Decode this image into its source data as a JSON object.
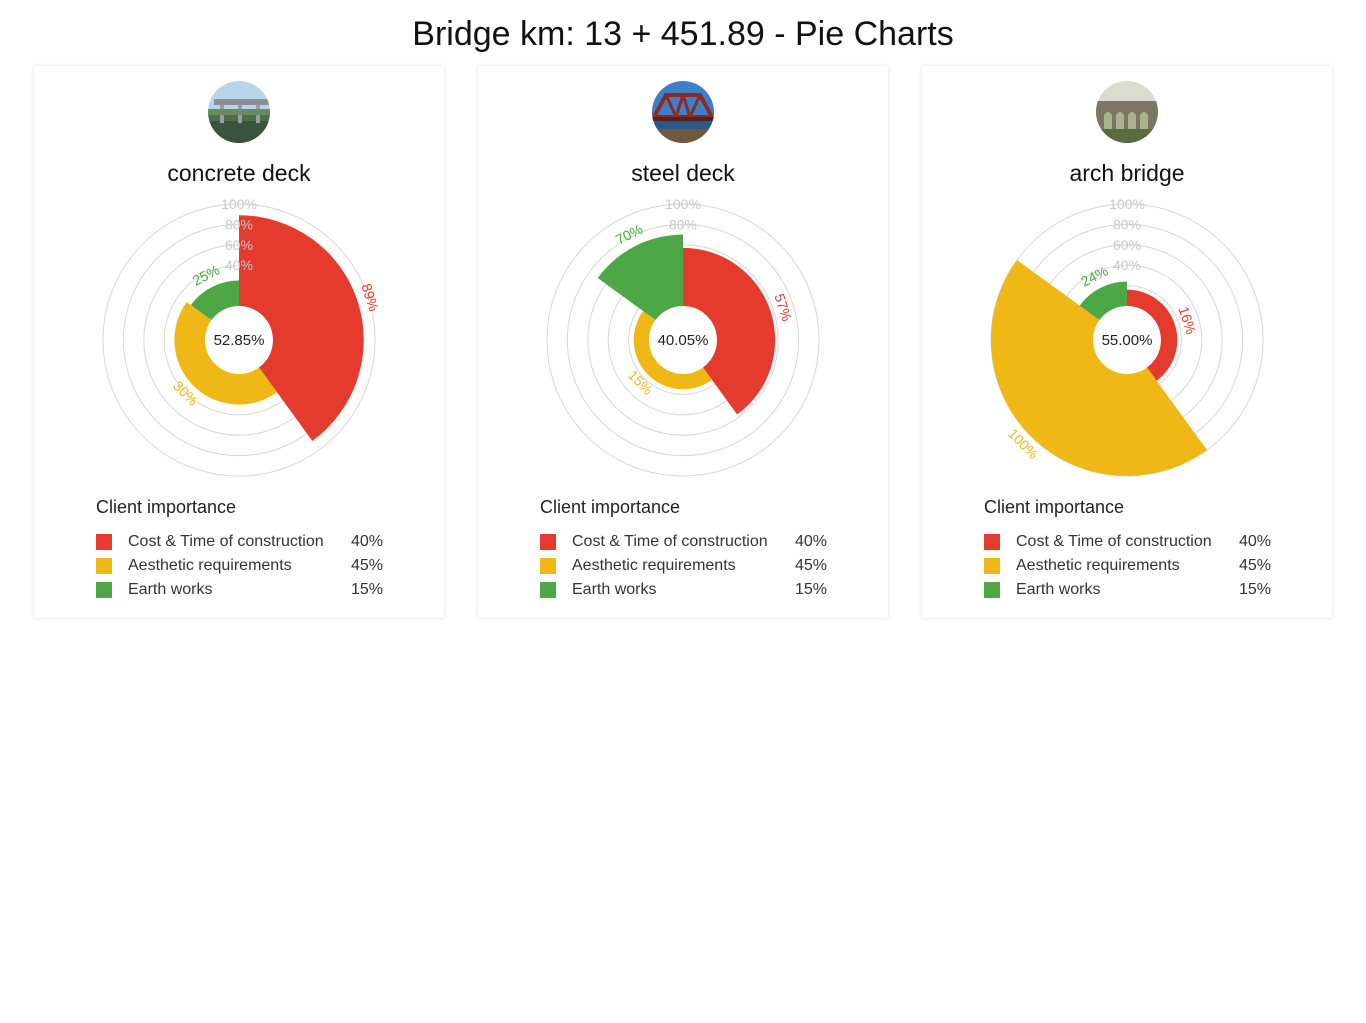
{
  "page": {
    "title": "Bridge km: 13 + 451.89 - Pie Charts"
  },
  "colors": {
    "red": "#e53b2f",
    "yellow": "#f0b816",
    "green": "#4ca744",
    "grid": "#d6d6d6",
    "tick": "#c8c8c8"
  },
  "legend_title": "Client importance",
  "legend": [
    {
      "label": "Cost & Time of construction",
      "value": "40%",
      "color": "#e53b2f"
    },
    {
      "label": "Aesthetic requirements",
      "value": "45%",
      "color": "#f0b816"
    },
    {
      "label": "Earth works",
      "value": "15%",
      "color": "#4ca744"
    }
  ],
  "cards": [
    {
      "title": "concrete deck",
      "image_icon": "concrete-bridge-photo",
      "center_label": "52.85%"
    },
    {
      "title": "steel deck",
      "image_icon": "steel-truss-bridge-photo",
      "center_label": "40.05%"
    },
    {
      "title": "arch bridge",
      "image_icon": "stone-arch-viaduct-photo",
      "center_label": "55.00%"
    }
  ],
  "chart_data": [
    {
      "type": "polar-area",
      "title": "concrete deck",
      "center_label": "52.85%",
      "radial_ticks": [
        "",
        "40%",
        "60%",
        "80%",
        "100%"
      ],
      "ylim": [
        0,
        100
      ],
      "categories": [
        "Cost & Time of construction",
        "Aesthetic requirements",
        "Earth works"
      ],
      "weights": [
        40,
        45,
        15
      ],
      "values": [
        89,
        30,
        25
      ],
      "labels": [
        "89%",
        "30%",
        "25%"
      ]
    },
    {
      "type": "polar-area",
      "title": "steel deck",
      "center_label": "40.05%",
      "radial_ticks": [
        "",
        "",
        "",
        "80%",
        "100%"
      ],
      "ylim": [
        0,
        100
      ],
      "categories": [
        "Cost & Time of construction",
        "Aesthetic requirements",
        "Earth works"
      ],
      "weights": [
        40,
        45,
        15
      ],
      "values": [
        57,
        15,
        70
      ],
      "labels": [
        "57%",
        "15%",
        "70%"
      ]
    },
    {
      "type": "polar-area",
      "title": "arch bridge",
      "center_label": "55.00%",
      "radial_ticks": [
        "",
        "40%",
        "60%",
        "80%",
        "100%"
      ],
      "ylim": [
        0,
        100
      ],
      "categories": [
        "Cost & Time of construction",
        "Aesthetic requirements",
        "Earth works"
      ],
      "weights": [
        40,
        45,
        15
      ],
      "values": [
        16,
        100,
        24
      ],
      "labels": [
        "16%",
        "100%",
        "24%"
      ]
    }
  ]
}
